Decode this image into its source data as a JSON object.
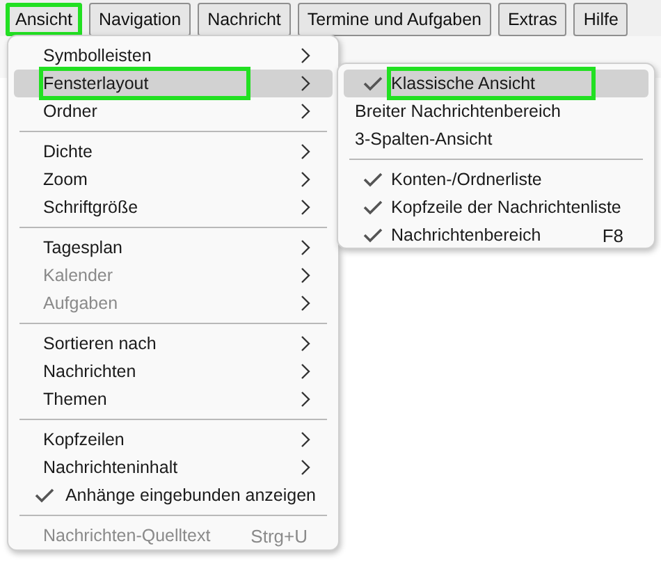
{
  "menubar": [
    {
      "label": "Ansicht",
      "highlighted": true
    },
    {
      "label": "Navigation",
      "highlighted": false
    },
    {
      "label": "Nachricht",
      "highlighted": false
    },
    {
      "label": "Termine und Aufgaben",
      "highlighted": false
    },
    {
      "label": "Extras",
      "highlighted": false
    },
    {
      "label": "Hilfe",
      "highlighted": false
    }
  ],
  "menu": {
    "items": [
      {
        "kind": "submenu",
        "label": "Symbolleisten",
        "selected": false,
        "disabled": false,
        "highlighted": false
      },
      {
        "kind": "submenu",
        "label": "Fensterlayout",
        "selected": true,
        "disabled": false,
        "highlighted": true
      },
      {
        "kind": "submenu",
        "label": "Ordner",
        "selected": false,
        "disabled": false,
        "highlighted": false
      },
      {
        "kind": "separator"
      },
      {
        "kind": "submenu",
        "label": "Dichte",
        "selected": false,
        "disabled": false,
        "highlighted": false
      },
      {
        "kind": "submenu",
        "label": "Zoom",
        "selected": false,
        "disabled": false,
        "highlighted": false
      },
      {
        "kind": "submenu",
        "label": "Schriftgröße",
        "selected": false,
        "disabled": false,
        "highlighted": false
      },
      {
        "kind": "separator"
      },
      {
        "kind": "submenu",
        "label": "Tagesplan",
        "selected": false,
        "disabled": false,
        "highlighted": false
      },
      {
        "kind": "submenu",
        "label": "Kalender",
        "selected": false,
        "disabled": true,
        "highlighted": false
      },
      {
        "kind": "submenu",
        "label": "Aufgaben",
        "selected": false,
        "disabled": true,
        "highlighted": false
      },
      {
        "kind": "separator"
      },
      {
        "kind": "submenu",
        "label": "Sortieren nach",
        "selected": false,
        "disabled": false,
        "highlighted": false
      },
      {
        "kind": "submenu",
        "label": "Nachrichten",
        "selected": false,
        "disabled": false,
        "highlighted": false
      },
      {
        "kind": "submenu",
        "label": "Themen",
        "selected": false,
        "disabled": false,
        "highlighted": false
      },
      {
        "kind": "separator"
      },
      {
        "kind": "submenu",
        "label": "Kopfzeilen",
        "selected": false,
        "disabled": false,
        "highlighted": false
      },
      {
        "kind": "submenu",
        "label": "Nachrichteninhalt",
        "selected": false,
        "disabled": false,
        "highlighted": false
      },
      {
        "kind": "check",
        "label": "Anhänge eingebunden anzeigen",
        "checked": true,
        "selected": false,
        "disabled": false,
        "highlighted": false
      },
      {
        "kind": "separator"
      },
      {
        "kind": "command",
        "label": "Nachrichten-Quelltext",
        "shortcut": "Strg+U",
        "selected": false,
        "disabled": true,
        "highlighted": false
      }
    ]
  },
  "submenu": {
    "items": [
      {
        "kind": "check",
        "label": "Klassische Ansicht",
        "checked": true,
        "selected": true,
        "disabled": false,
        "highlighted": true
      },
      {
        "kind": "command",
        "label": "Breiter Nachrichtenbereich",
        "selected": false,
        "disabled": false,
        "highlighted": false
      },
      {
        "kind": "command",
        "label": "3-Spalten-Ansicht",
        "selected": false,
        "disabled": false,
        "highlighted": false
      },
      {
        "kind": "separator"
      },
      {
        "kind": "check",
        "label": "Konten-/Ordnerliste",
        "checked": true,
        "selected": false,
        "disabled": false,
        "highlighted": false
      },
      {
        "kind": "check",
        "label": "Kopfzeile der Nachrichtenliste",
        "checked": true,
        "selected": false,
        "disabled": false,
        "highlighted": false
      },
      {
        "kind": "check",
        "label": "Nachrichtenbereich",
        "shortcut": "F8",
        "checked": true,
        "selected": false,
        "disabled": false,
        "highlighted": false
      }
    ]
  }
}
